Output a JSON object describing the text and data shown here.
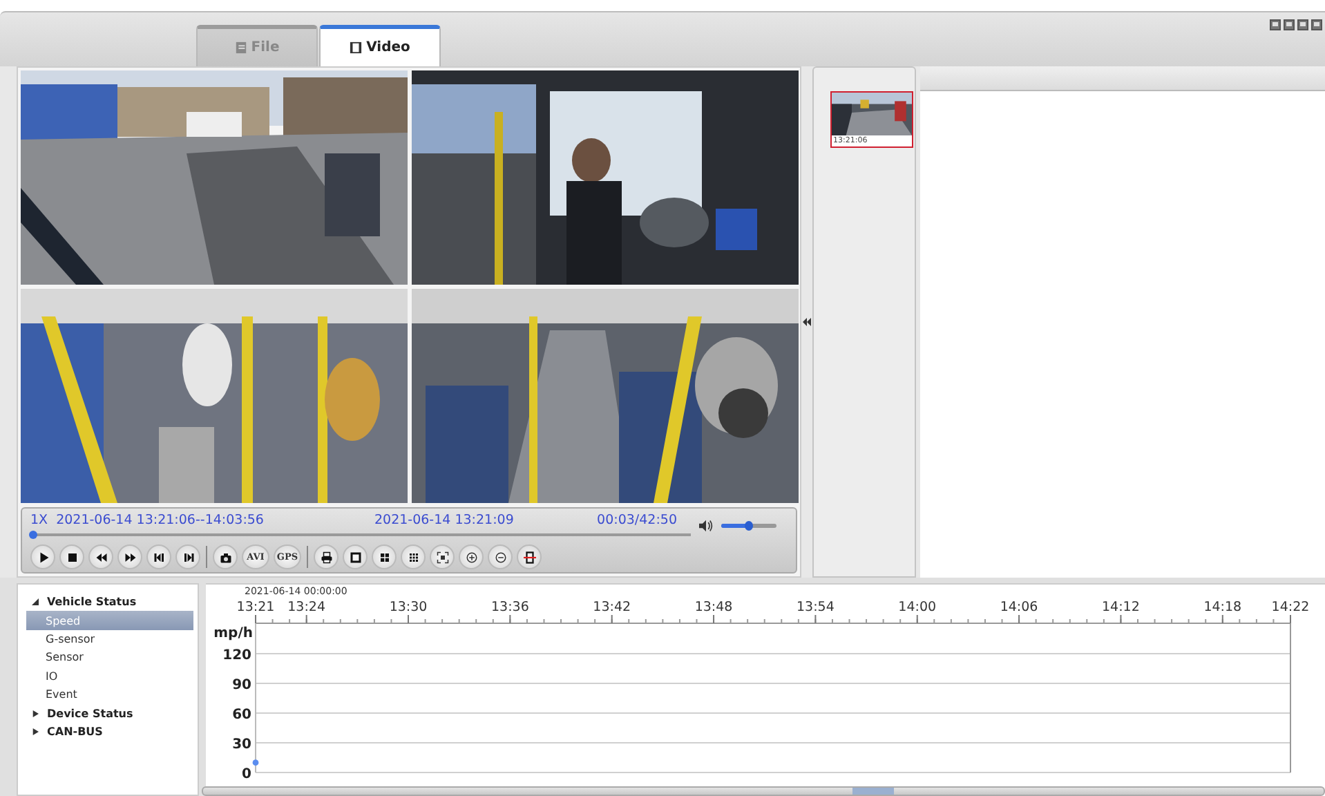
{
  "tabs": [
    {
      "label": "File",
      "kind": "file",
      "selected": false
    },
    {
      "label": "Video",
      "kind": "film",
      "selected": true
    }
  ],
  "videos": [
    {
      "kind": "street"
    },
    {
      "kind": "cab"
    },
    {
      "kind": "interior"
    },
    {
      "kind": "aisle"
    }
  ],
  "playback": {
    "speed": "1X",
    "range": "2021-06-14 13:21:06--14:03:56",
    "current": "2021-06-14 13:21:09",
    "elapsed": "00:03/42:50",
    "progress": {
      "level": 0.0
    },
    "volume": {
      "level": 0.5
    }
  },
  "controls": [
    {
      "kind": "play"
    },
    {
      "kind": "stop"
    },
    {
      "kind": "rewind"
    },
    {
      "kind": "forward"
    },
    {
      "kind": "prev"
    },
    {
      "kind": "next"
    },
    {
      "kind": "sep"
    },
    {
      "kind": "camera"
    },
    {
      "kind": "text",
      "label": "AVI"
    },
    {
      "kind": "text",
      "label": "GPS"
    },
    {
      "kind": "sep"
    },
    {
      "kind": "print"
    },
    {
      "kind": "single"
    },
    {
      "kind": "quad"
    },
    {
      "kind": "nine"
    },
    {
      "kind": "fullscreen"
    },
    {
      "kind": "zoomin"
    },
    {
      "kind": "zoomout"
    },
    {
      "kind": "crop"
    }
  ],
  "thumbnails": [
    {
      "time": "13:21:06",
      "selected": true
    }
  ],
  "tree": [
    {
      "label": "Vehicle Status",
      "expanded": true,
      "selected": false,
      "children": [
        {
          "label": "Speed",
          "selected": true
        },
        {
          "label": "G-sensor",
          "selected": false
        },
        {
          "label": "Sensor",
          "selected": false
        },
        {
          "label": "IO",
          "selected": false
        },
        {
          "label": "Event",
          "selected": false
        }
      ]
    },
    {
      "label": "Device Status",
      "expanded": false,
      "selected": false
    },
    {
      "label": "CAN-BUS",
      "expanded": false,
      "selected": false
    }
  ],
  "chart": {
    "date_label": "2021-06-14 00:00:00",
    "chart_data": {
      "type": "line",
      "grid": true,
      "ylabel": "mp/h",
      "ylim": [
        0,
        120
      ],
      "categories": [
        "13:21",
        null,
        null,
        "13:24",
        null,
        null,
        null,
        null,
        null,
        "13:30",
        null,
        null,
        null,
        null,
        null,
        "13:36",
        null,
        null,
        null,
        null,
        null,
        "13:42",
        null,
        null,
        null,
        null,
        null,
        "13:48",
        null,
        null,
        null,
        null,
        null,
        "13:54",
        null,
        null,
        null,
        null,
        null,
        "14:00",
        null,
        null,
        null,
        null,
        null,
        "14:06",
        null,
        null,
        null,
        null,
        null,
        "14:12",
        null,
        null,
        null,
        null,
        null,
        "14:18",
        null,
        null,
        null,
        "14:22"
      ],
      "yticks": [
        0,
        30,
        60,
        90,
        120
      ],
      "series": [
        {
          "color": "#5b8def",
          "marker": true,
          "values": [
            10,
            null,
            null,
            null,
            null,
            null,
            null,
            null,
            null,
            null,
            null,
            null,
            null,
            null,
            null,
            null,
            null,
            null,
            null,
            null,
            null,
            null,
            null,
            null,
            null,
            null,
            null,
            null,
            null,
            null,
            null,
            null,
            null,
            null,
            null,
            null,
            null,
            null,
            null,
            null,
            null,
            null,
            null,
            null,
            null,
            null,
            null,
            null,
            null,
            null,
            null,
            null,
            null,
            null,
            null,
            null,
            null,
            null,
            null,
            null,
            null,
            null
          ]
        }
      ]
    }
  }
}
